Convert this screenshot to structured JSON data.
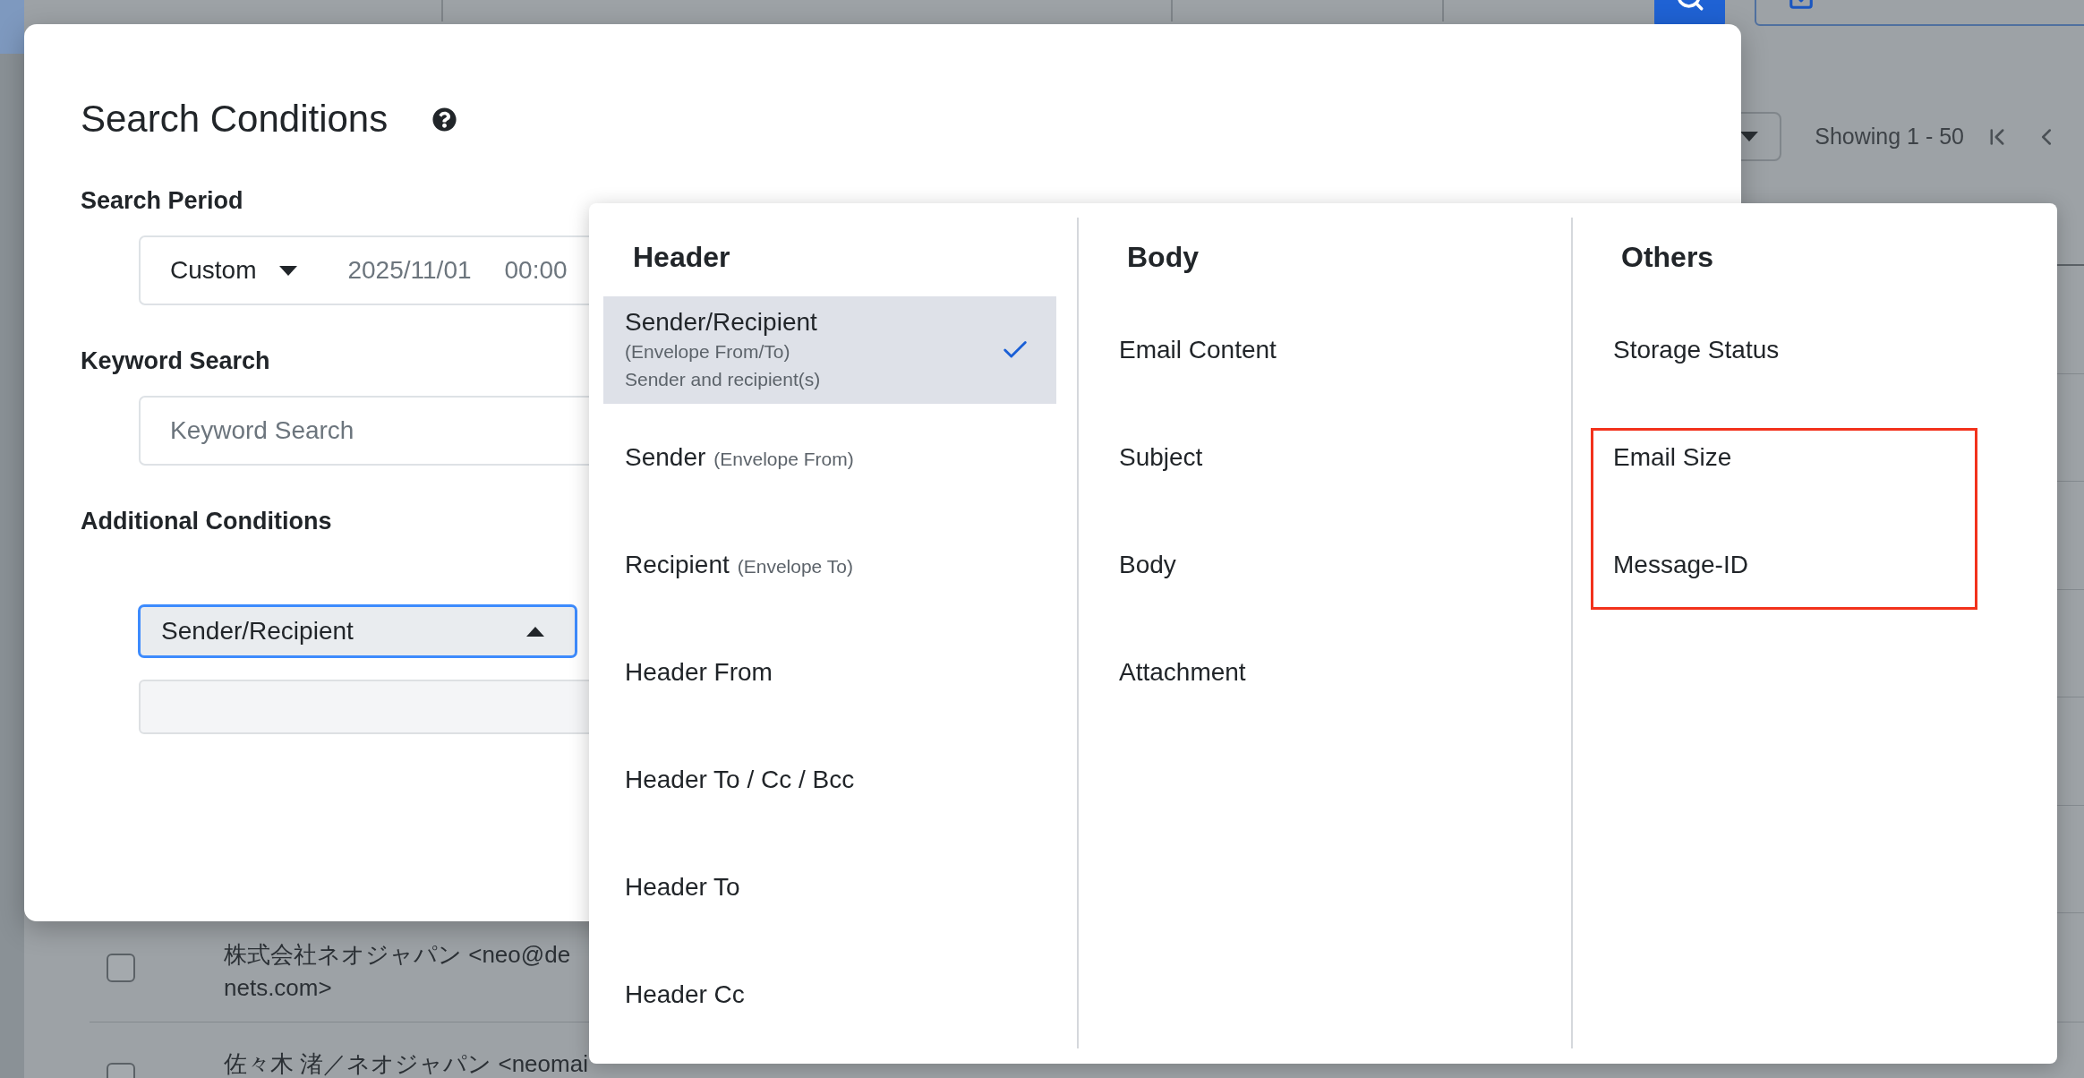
{
  "app": {
    "pagination": {
      "showing": "Showing 1 - 50"
    },
    "table": {
      "rows": [
        {
          "checked": false,
          "sender_lines": [
            "株式会社ネオジャパン <neo@de",
            "nets.com>"
          ]
        },
        {
          "checked": false,
          "sender_lines": [
            "佐々木 渚／ネオジャパン <neomai"
          ]
        }
      ]
    }
  },
  "modal": {
    "title": "Search Conditions",
    "period": {
      "label": "Search Period",
      "mode": "Custom",
      "date_from": "2025/11/01",
      "time_from": "00:00"
    },
    "keyword": {
      "label": "Keyword Search",
      "placeholder": "Keyword Search"
    },
    "additional": {
      "label": "Additional Conditions",
      "select": {
        "value": "Sender/Recipient",
        "expanded": true
      },
      "value_field": {
        "disabled": true
      }
    }
  },
  "condition_menu": {
    "columns": [
      {
        "heading": "Header",
        "items": [
          {
            "label": "Sender/Recipient",
            "note": "(Envelope From/To)",
            "description": "Sender and recipient(s)",
            "selected": true,
            "highlighted": false
          },
          {
            "label": "Sender",
            "note": "(Envelope From)",
            "selected": false,
            "highlighted": false
          },
          {
            "label": "Recipient",
            "note": "(Envelope To)",
            "selected": false,
            "highlighted": false
          },
          {
            "label": "Header From",
            "selected": false,
            "highlighted": false
          },
          {
            "label": "Header To / Cc / Bcc",
            "selected": false,
            "highlighted": false
          },
          {
            "label": "Header To",
            "selected": false,
            "highlighted": false
          },
          {
            "label": "Header Cc",
            "selected": false,
            "highlighted": false
          }
        ]
      },
      {
        "heading": "Body",
        "items": [
          {
            "label": "Email Content",
            "selected": false,
            "highlighted": false
          },
          {
            "label": "Subject",
            "selected": false,
            "highlighted": false
          },
          {
            "label": "Body",
            "selected": false,
            "highlighted": false
          },
          {
            "label": "Attachment",
            "selected": false,
            "highlighted": false
          }
        ]
      },
      {
        "heading": "Others",
        "items": [
          {
            "label": "Storage Status",
            "selected": false,
            "highlighted": false
          },
          {
            "label": "Email Size",
            "selected": false,
            "highlighted": true
          },
          {
            "label": "Message-ID",
            "selected": false,
            "highlighted": true
          }
        ]
      }
    ]
  }
}
